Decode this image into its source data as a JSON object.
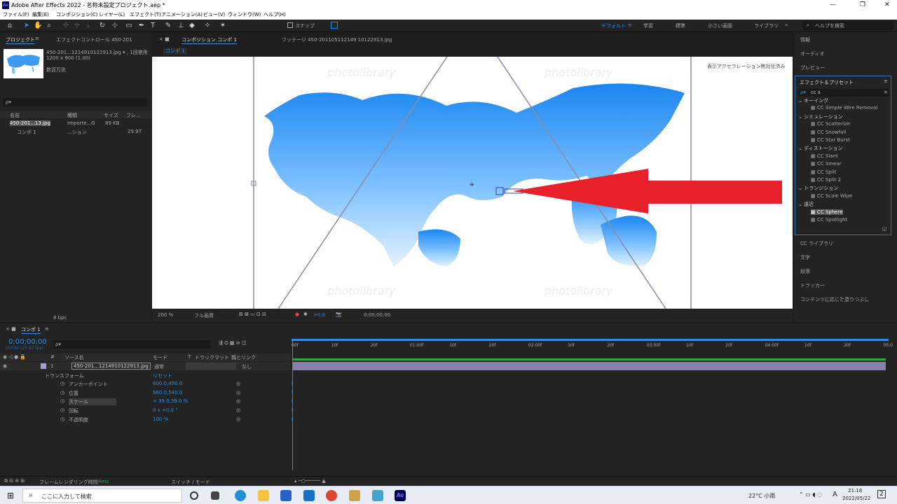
{
  "window": {
    "title": "Adobe After Effects 2022 - 名称未設定プロジェクト.aep *",
    "min": "—",
    "max": "❐",
    "close": "✕",
    "logo": "Ae"
  },
  "menu": [
    "ファイル(F)",
    "編集(E)",
    "コンポジション(C)",
    "レイヤー(L)",
    "エフェクト(T)",
    "アニメーション(A)",
    "ビュー(V)",
    "ウィンドウ(W)",
    "ヘルプ(H)"
  ],
  "toolbar": {
    "snap": "スナップ",
    "workspaces": [
      "デフォルト",
      "学習",
      "標準",
      "小さい画面",
      "ライブラリ"
    ],
    "help_search": "ヘルプを検索",
    "more": "»"
  },
  "project": {
    "tab": "プロジェクト",
    "effect_tab": "エフェクトコントロール 450-201",
    "file": "450-201...1214910122913.jpg ▾ , 1回使用",
    "dims": "1200 x 900 (1.00)",
    "colors": "数百万色",
    "search": "ρ▾",
    "cols": [
      "名前",
      "種類",
      "サイズ",
      "フレ..."
    ],
    "items": [
      {
        "name": "450-201...13.jpg",
        "type": "Importe...G",
        "size": "89 KB",
        "fr": ""
      },
      {
        "name": "コンポ 1",
        "type": "...ション",
        "size": "",
        "fr": "29.97"
      }
    ],
    "bpc": "8 bpc"
  },
  "comp": {
    "tab": "コンポジション コンポ 1",
    "footage_tab": "フッテージ 450-201105112149 10122913.jpg",
    "sub": "コンポ 1",
    "accel": "表示アクセラレーション無効化済み",
    "watermark": "photolibrary",
    "zoom": "200 %",
    "quality": "フル画質",
    "exposure": "+0.0",
    "time": "0;00;00;00"
  },
  "right": {
    "info": "情報",
    "audio": "オーディオ",
    "preview": "プレビュー",
    "effects_title": "エフェクト＆プリセット",
    "search": "cc s",
    "groups": [
      {
        "name": "キーイング",
        "items": [
          "CC Simple Wire Removal"
        ]
      },
      {
        "name": "シミュレーション",
        "items": [
          "CC Scatterize",
          "CC Snowfall",
          "CC Star Burst"
        ]
      },
      {
        "name": "ディストーション",
        "items": [
          "CC Slant",
          "CC Smear",
          "CC Split",
          "CC Split 2"
        ]
      },
      {
        "name": "トランジション",
        "items": [
          "CC Scale Wipe"
        ]
      },
      {
        "name": "遠近",
        "items": [
          "CC Sphere",
          "CC Spotlight"
        ]
      }
    ],
    "lower": [
      "CC ライブラリ",
      "文字",
      "段落",
      "トラッカー",
      "コンテンツに応じた塗りつぶし"
    ]
  },
  "timeline": {
    "tab": "コンポ 1",
    "time": "0;00;00;00",
    "fps": "00000 (29.97 fps)",
    "search": "ρ▾",
    "cols": {
      "num": "#",
      "src": "ソース名",
      "mode": "モード",
      "t": "T",
      "track": "トラックマット",
      "parent": "親とリンク"
    },
    "layer": {
      "num": "1",
      "name": "450-201...1214910122913.jpg",
      "mode": "通常",
      "parent": "なし"
    },
    "transform": "トランスフォーム",
    "reset": "リセット",
    "props": [
      {
        "name": "アンカーポイント",
        "value": "600.0,450.0"
      },
      {
        "name": "位置",
        "value": "960.0,540.0"
      },
      {
        "name": "スケール",
        "value": "∞ 39.0,39.0 %"
      },
      {
        "name": "回転",
        "value": "0 x +0.0 °"
      },
      {
        "name": "不透明度",
        "value": "100 %"
      }
    ],
    "ruler": [
      "00f",
      "10f",
      "20f",
      "01:00f",
      "10f",
      "20f",
      "02:00f",
      "10f",
      "20f",
      "03:00f",
      "10f",
      "20f",
      "04:00f",
      "10f",
      "20f",
      "05:0"
    ],
    "render_time": "フレームレンダリング時間",
    "render_val": "4ms",
    "switch_mode": "スイッチ / モード"
  },
  "taskbar": {
    "search": "ここに入力して検索",
    "weather": "22°C 小雨",
    "time": "21:18",
    "date": "2022/05/22",
    "lang": "A",
    "notif": "2"
  },
  "colors": {
    "accent": "#2d8ceb",
    "arrow": "#e8202a",
    "panel": "#232323"
  }
}
